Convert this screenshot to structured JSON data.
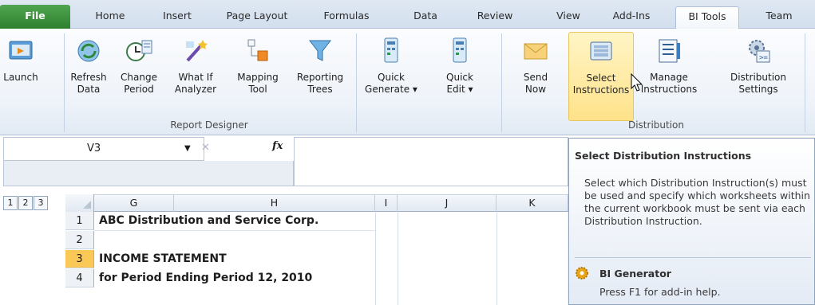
{
  "tabs": [
    {
      "label": "File"
    },
    {
      "label": "Home"
    },
    {
      "label": "Insert"
    },
    {
      "label": "Page Layout"
    },
    {
      "label": "Formulas"
    },
    {
      "label": "Data"
    },
    {
      "label": "Review"
    },
    {
      "label": "View"
    },
    {
      "label": "Add-Ins"
    },
    {
      "label": "BI Tools"
    },
    {
      "label": "Team"
    }
  ],
  "ribbon": {
    "launch": {
      "line1": "Launch",
      "line2": ""
    },
    "refresh": {
      "line1": "Refresh",
      "line2": "Data"
    },
    "change_period": {
      "line1": "Change",
      "line2": "Period"
    },
    "what_if": {
      "line1": "What If",
      "line2": "Analyzer"
    },
    "mapping": {
      "line1": "Mapping",
      "line2": "Tool"
    },
    "reporting": {
      "line1": "Reporting",
      "line2": "Trees"
    },
    "quick_generate": {
      "line1": "Quick",
      "line2": "Generate ▾"
    },
    "quick_edit": {
      "line1": "Quick",
      "line2": "Edit ▾"
    },
    "send_now": {
      "line1": "Send",
      "line2": "Now"
    },
    "select_instr": {
      "line1": "Select",
      "line2": "Instructions"
    },
    "manage_instr": {
      "line1": "Manage",
      "line2": "Instructions"
    },
    "dist_settings": {
      "line1": "Distribution",
      "line2": "Settings"
    },
    "groups": {
      "report_designer": "Report Designer",
      "distribution": "Distribution"
    }
  },
  "formula_bar": {
    "name_box": "V3",
    "fx": "fx",
    "cancel": "✕"
  },
  "grid": {
    "outline_levels": [
      "1",
      "2",
      "3"
    ],
    "columns": [
      "G",
      "H",
      "I",
      "J",
      "K"
    ],
    "rows": [
      {
        "num": "1",
        "text": "ABC Distribution and Service Corp."
      },
      {
        "num": "2",
        "text": ""
      },
      {
        "num": "3",
        "text": "INCOME STATEMENT"
      },
      {
        "num": "4",
        "text": "for Period Ending Period 12, 2010"
      }
    ]
  },
  "tooltip": {
    "title": "Select Distribution Instructions",
    "body": "Select which Distribution Instruction(s) must be used and specify which worksheets within the current workbook must be sent via each Distribution Instruction.",
    "generator_title": "BI Generator",
    "help": "Press F1 for add-in help."
  },
  "colors": {
    "file_tab": "#3b8f3b",
    "highlight": "#ffe28a",
    "selected_row": "#f9c857"
  }
}
